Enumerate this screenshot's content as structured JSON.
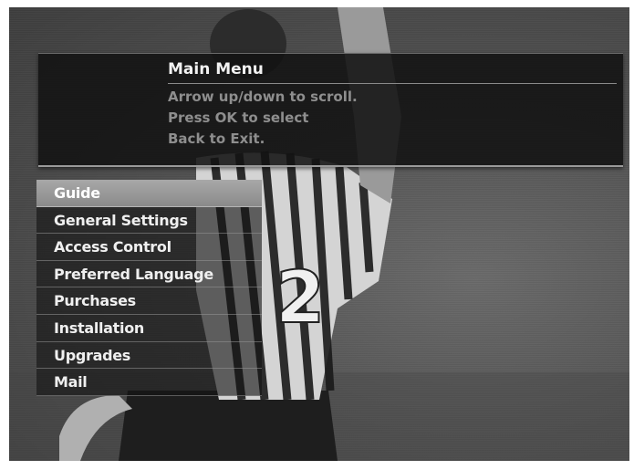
{
  "banner": {
    "title": "Main Menu",
    "instructions": [
      "Arrow up/down to scroll.",
      "Press OK to select",
      "Back to Exit."
    ]
  },
  "menu": {
    "selected_index": 0,
    "items": [
      {
        "label": "Guide"
      },
      {
        "label": "General Settings"
      },
      {
        "label": "Access Control"
      },
      {
        "label": "Preferred Language"
      },
      {
        "label": "Purchases"
      },
      {
        "label": "Installation"
      },
      {
        "label": "Upgrades"
      },
      {
        "label": "Mail"
      }
    ]
  }
}
